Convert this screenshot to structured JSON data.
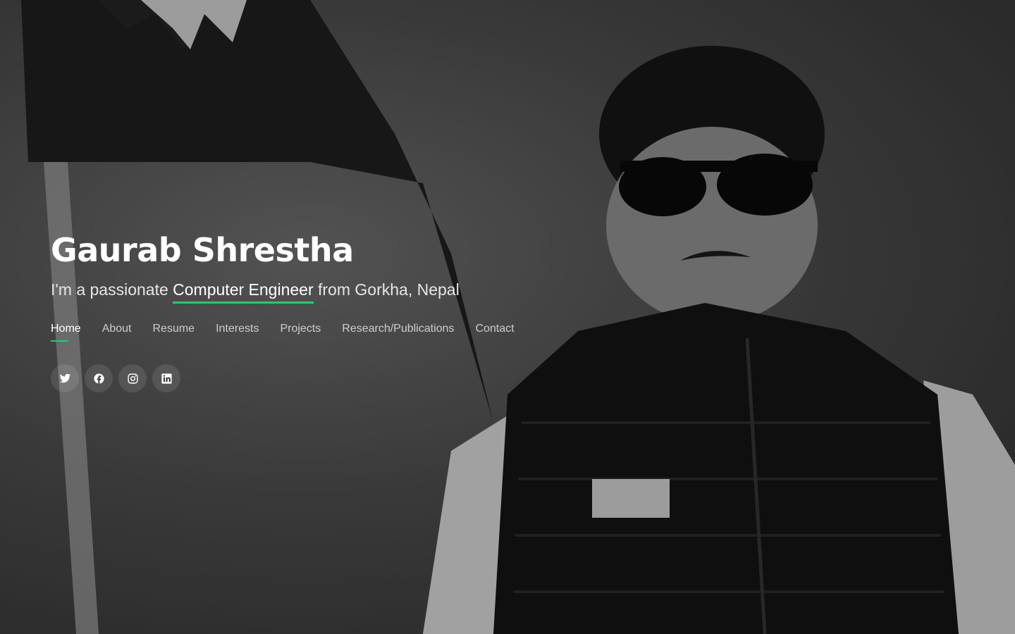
{
  "hero": {
    "name": "Gaurab Shrestha",
    "tagline_prefix": "I'm a passionate ",
    "tagline_highlight": "Computer Engineer",
    "tagline_suffix": " from Gorkha, Nepal"
  },
  "nav": {
    "items": [
      {
        "label": "Home",
        "active": true
      },
      {
        "label": "About"
      },
      {
        "label": "Resume"
      },
      {
        "label": "Interests"
      },
      {
        "label": "Projects"
      },
      {
        "label": "Research/Publications"
      },
      {
        "label": "Contact"
      }
    ]
  },
  "socials": [
    "twitter-icon",
    "facebook-icon",
    "instagram-icon",
    "linkedin-icon"
  ],
  "colors": {
    "accent": "#18d26e",
    "text": "#ffffff"
  }
}
